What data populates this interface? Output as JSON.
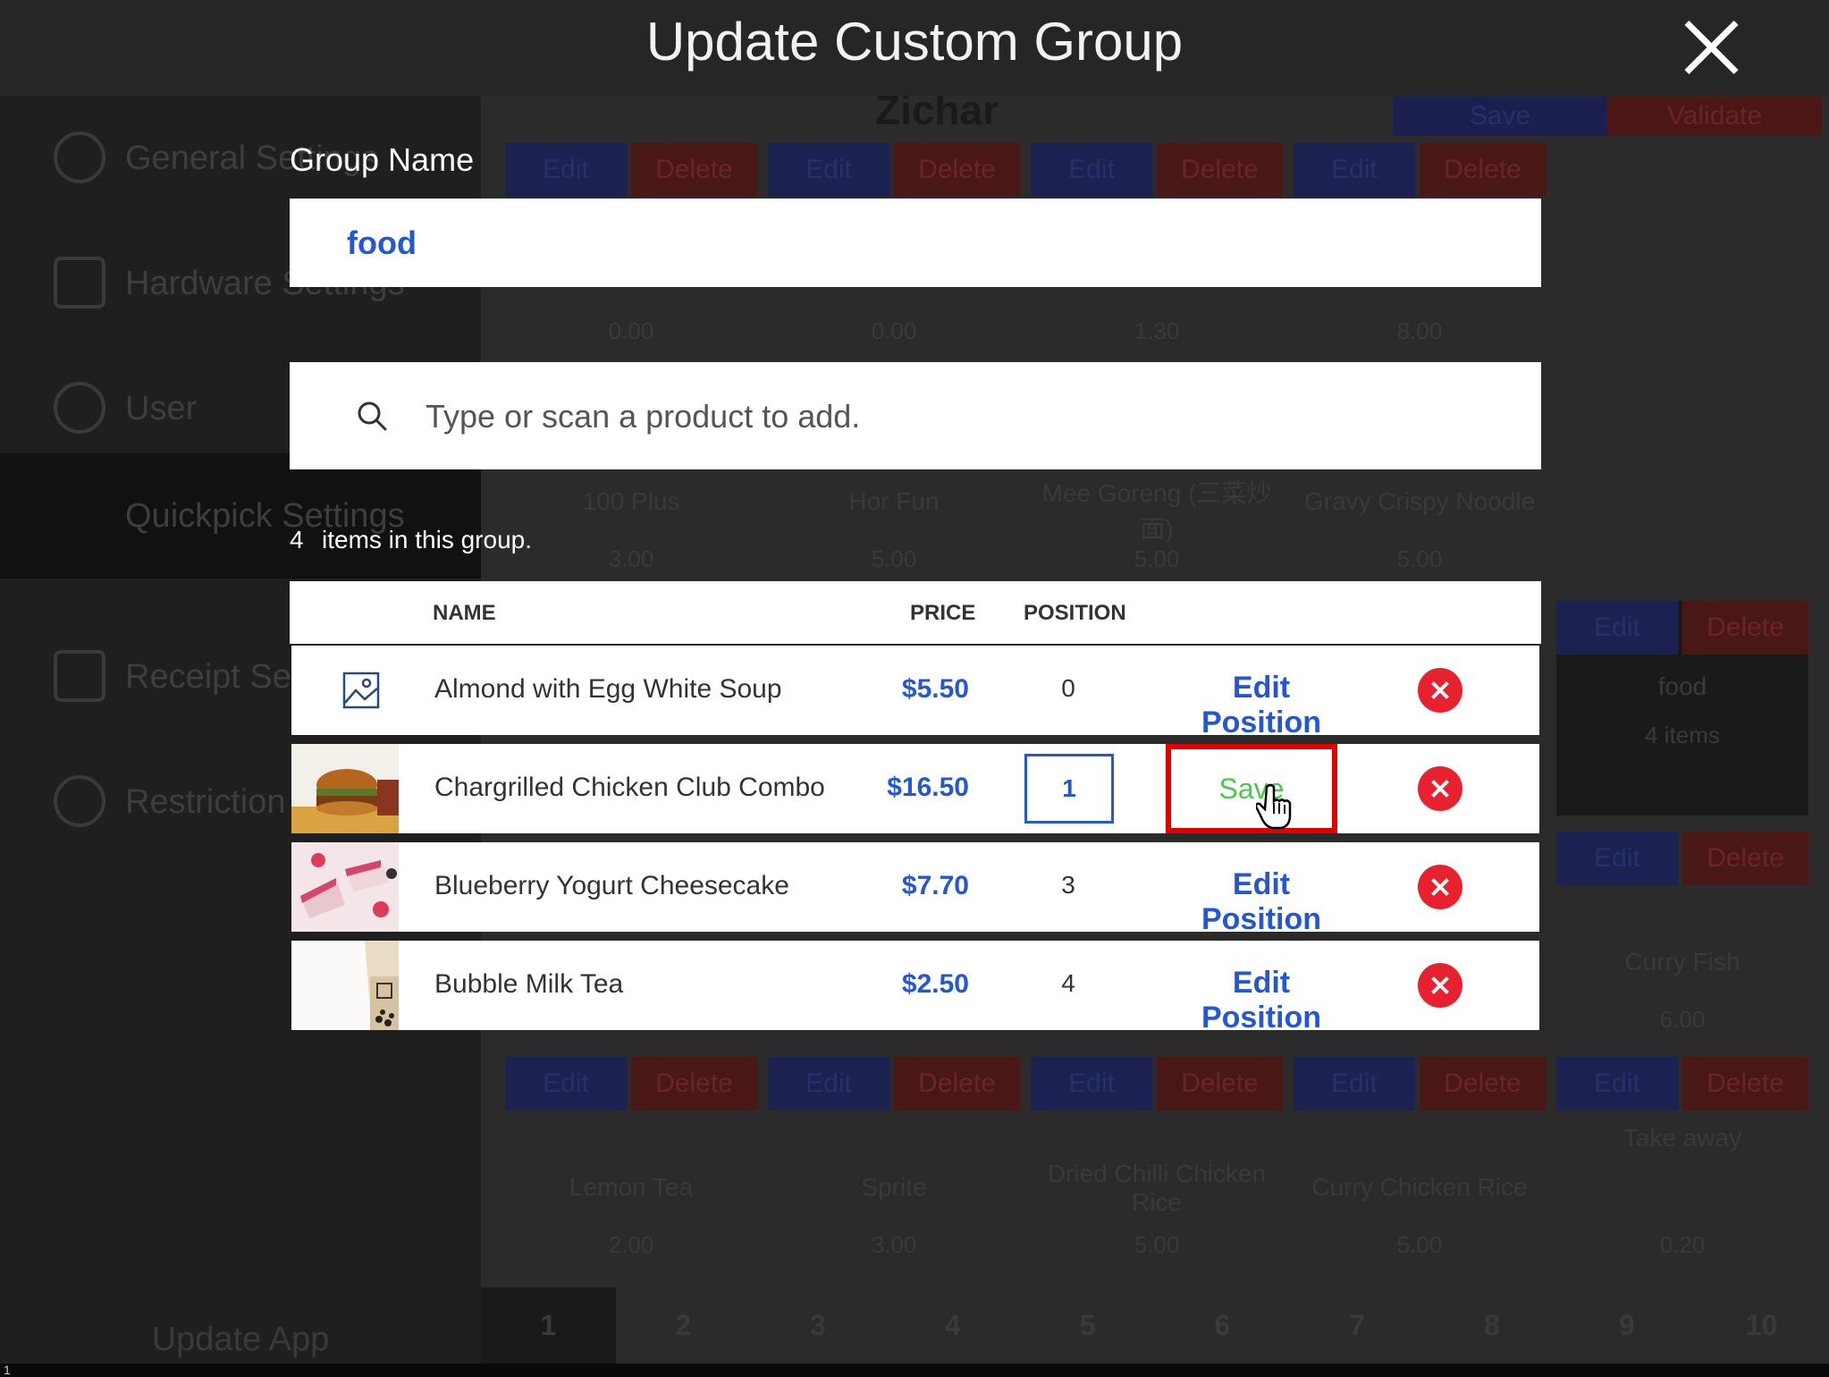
{
  "modal": {
    "title": "Update Custom Group",
    "group_name_label": "Group Name",
    "group_name_value": "food",
    "search_placeholder": "Type or scan a product to add.",
    "item_count": "4",
    "item_count_suffix": "items in this group.",
    "close_icon": "close-icon"
  },
  "table": {
    "headers": {
      "name": "NAME",
      "price": "PRICE",
      "position": "POSITION"
    },
    "rows": [
      {
        "name": "Almond with Egg White Soup",
        "price": "$5.50",
        "position": "0",
        "action": "Edit Position",
        "thumb": "image-placeholder-icon"
      },
      {
        "name": "Chargrilled Chicken Club Combo",
        "price": "$16.50",
        "position": "1",
        "action": "Save",
        "thumb": "burger-photo"
      },
      {
        "name": "Blueberry Yogurt Cheesecake",
        "price": "$7.70",
        "position": "3",
        "action": "Edit Position",
        "thumb": "cheesecake-photo"
      },
      {
        "name": "Bubble Milk Tea",
        "price": "$2.50",
        "position": "4",
        "action": "Edit Position",
        "thumb": "milk-tea-photo"
      }
    ]
  },
  "background": {
    "title": "Zichar",
    "save": "Save",
    "validate": "Validate",
    "sidebar": [
      "General Settings",
      "Hardware Settings",
      "User",
      "Quickpick Settings",
      "Receipt Settings",
      "Restriction"
    ],
    "update_app": "Update App",
    "edit": "Edit",
    "delete": "Delete",
    "tiles": [
      {
        "name": "100 Plus",
        "price": "3.00"
      },
      {
        "name": "Hor Fun",
        "price": "5.00"
      },
      {
        "name": "Mee Goreng (三菜炒面)",
        "price": "5.00"
      },
      {
        "name": "Gravy Crispy Noodle",
        "price": "5.00"
      },
      {
        "name": "food",
        "price": "4 items"
      },
      {
        "name": "Curry Fish",
        "price": "6.00"
      },
      {
        "name": "Lemon Tea",
        "price": "2.00"
      },
      {
        "name": "Sprite",
        "price": "3.00"
      },
      {
        "name": "Dried Chilli Chicken Rice",
        "price": "5.00"
      },
      {
        "name": "Curry Chicken Rice",
        "price": "5.00"
      },
      {
        "name": "Take away",
        "price": "0.20"
      }
    ],
    "top_prices": [
      "0.00",
      "0.00",
      "1.30",
      "8.00"
    ],
    "pages": [
      "1",
      "2",
      "3",
      "4",
      "5",
      "6",
      "7",
      "8",
      "9",
      "10"
    ],
    "corner_digit": "1"
  },
  "colors": {
    "accent": "#2457d4",
    "danger": "#e8212f",
    "highlight": "#e00000",
    "save_text": "#4cc94c"
  }
}
